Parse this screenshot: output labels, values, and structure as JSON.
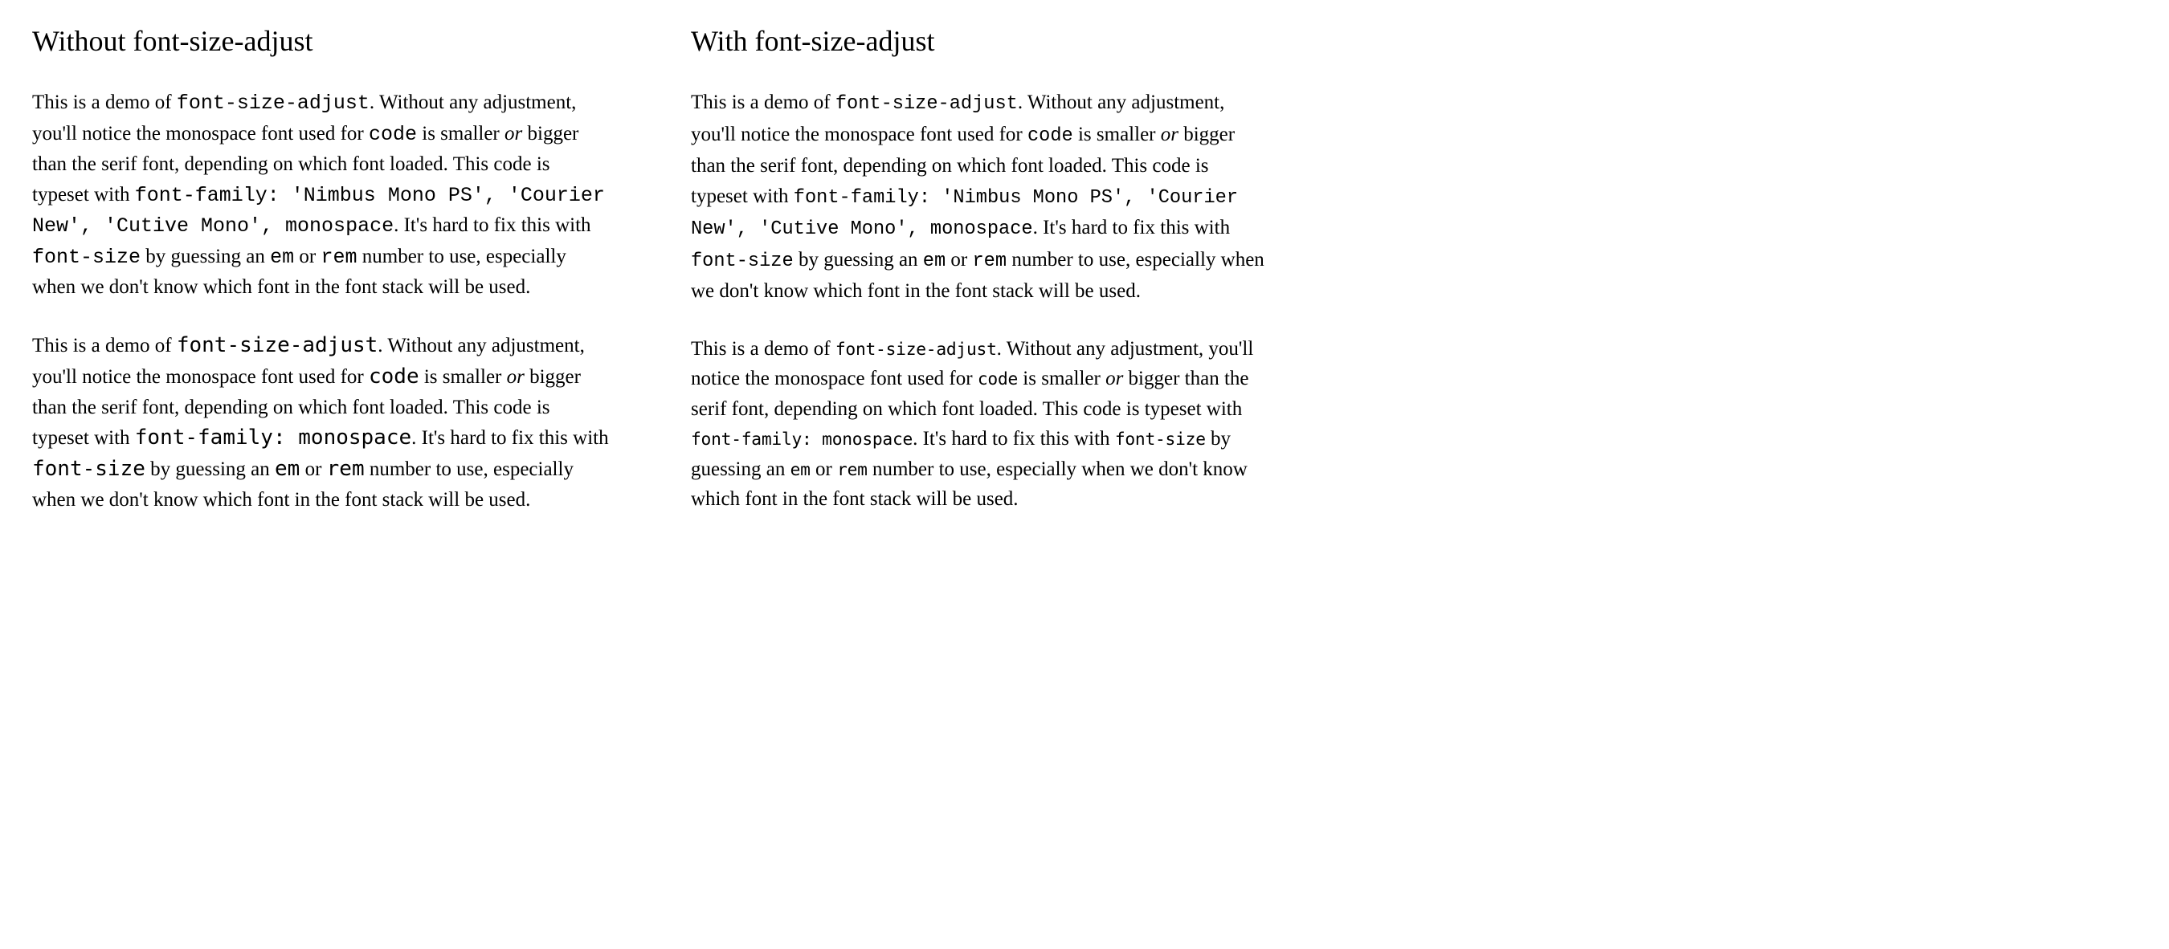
{
  "left": {
    "heading": "Without font-size-adjust"
  },
  "right": {
    "heading": "With font-size-adjust"
  },
  "paragraph": {
    "t1": "This is a demo of ",
    "c_fsa": "font-size-adjust",
    "t2": ". Without any adjustment, you'll notice the monospace font used for ",
    "c_code": "code",
    "t3": " is smaller ",
    "em_or": "or",
    "t4": " bigger than the serif font, depending on which font loaded. This code is typeset with ",
    "c_ff_full": "font-family: 'Nimbus Mono PS', 'Courier New', 'Cutive Mono', monospace",
    "c_ff_short": "font-family: monospace",
    "t5": ". It's hard to fix this with ",
    "c_fs": "font-size",
    "t6": " by guessing an ",
    "c_em": "em",
    "t7": " or ",
    "c_rem": "rem",
    "t8": " number to use, especially when we don't know which font in the font stack will be used."
  }
}
